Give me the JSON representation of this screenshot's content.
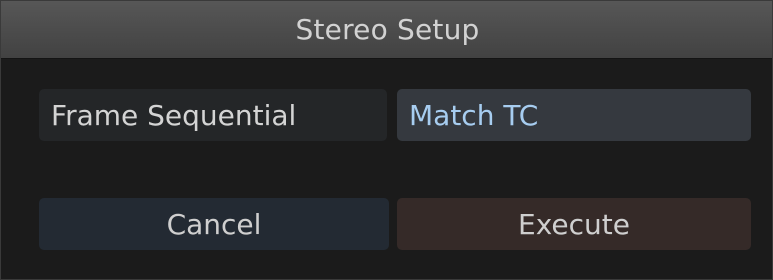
{
  "dialog": {
    "title": "Stereo Setup",
    "mode_label": "Frame Sequential",
    "mode_value": "Match TC",
    "buttons": {
      "cancel": "Cancel",
      "execute": "Execute"
    }
  },
  "colors": {
    "value_text": "#a7cdf0",
    "cancel_bg": "#232a33",
    "execute_bg": "#352a28"
  }
}
